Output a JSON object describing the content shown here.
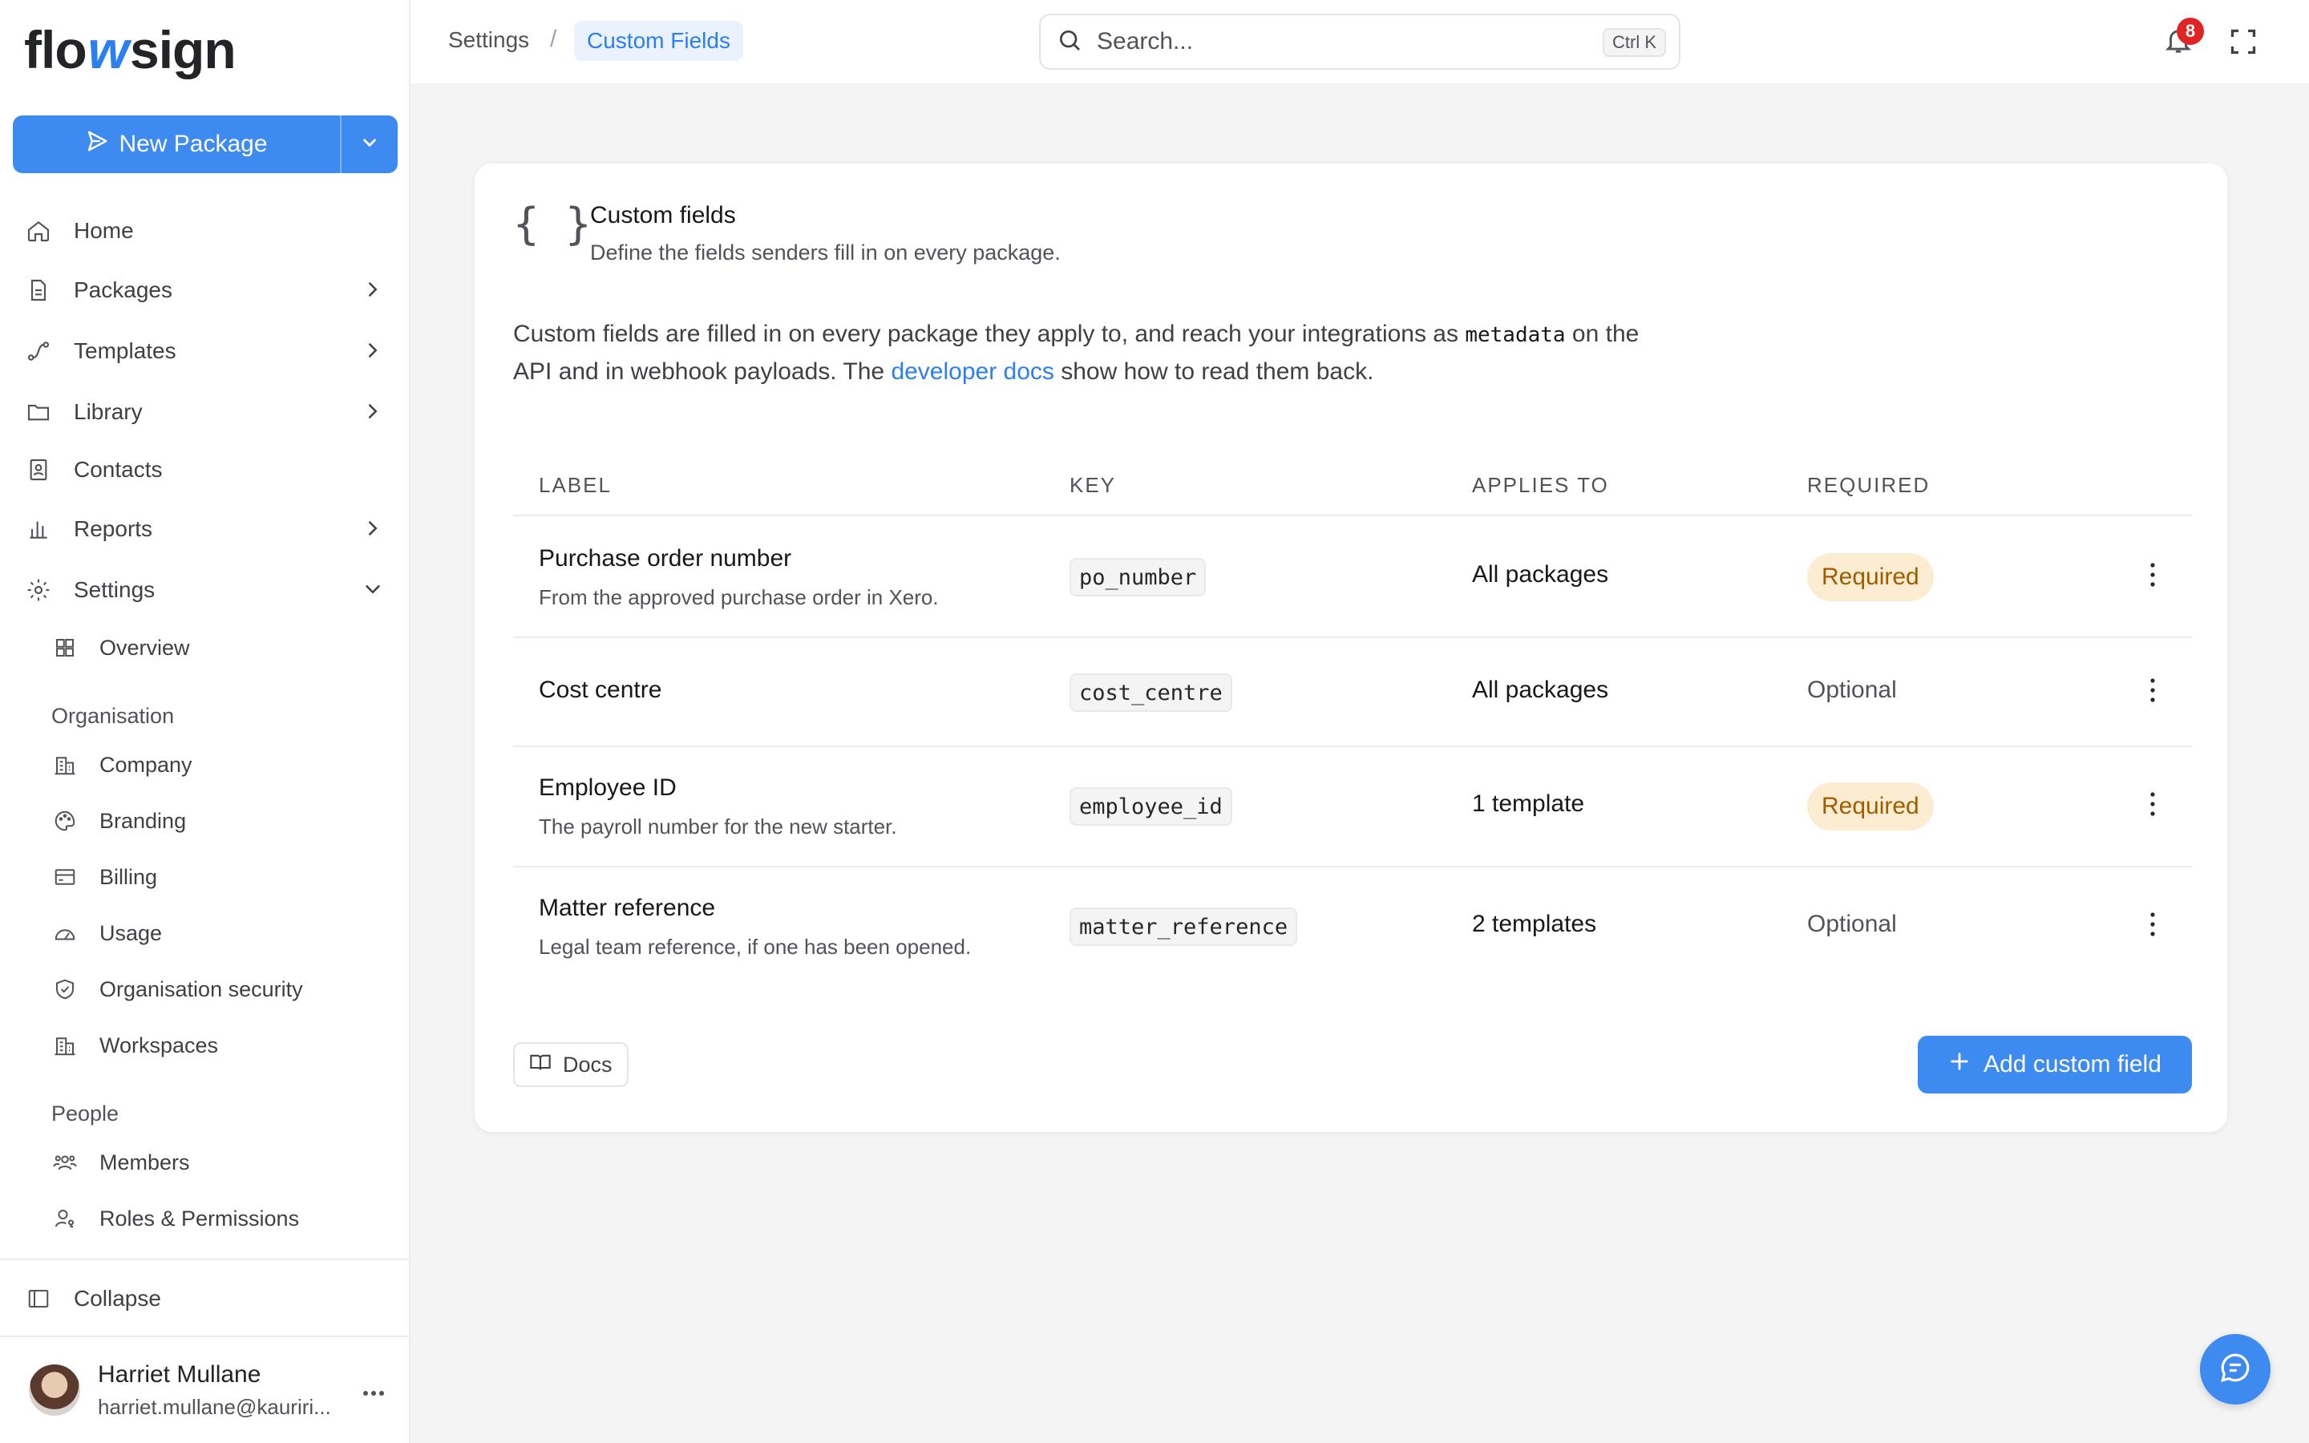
{
  "brand": {
    "logo_left": "flo",
    "logo_mid": "w",
    "logo_right": "sign",
    "accent": "#3d8bf0"
  },
  "sidebar": {
    "new_package_label": "New Package",
    "nav": [
      {
        "label": "Home",
        "icon": "home-icon"
      },
      {
        "label": "Packages",
        "icon": "document-icon"
      },
      {
        "label": "Templates",
        "icon": "route-icon"
      },
      {
        "label": "Library",
        "icon": "folder-icon"
      },
      {
        "label": "Contacts",
        "icon": "contact-book-icon"
      },
      {
        "label": "Reports",
        "icon": "bar-chart-icon"
      },
      {
        "label": "Settings",
        "icon": "gear-icon"
      }
    ],
    "settings_overview": "Overview",
    "org_section": "Organisation",
    "org_items": [
      "Company",
      "Branding",
      "Billing",
      "Usage",
      "Organisation security",
      "Workspaces"
    ],
    "people_section": "People",
    "people_items": [
      "Members",
      "Roles & Permissions"
    ],
    "collapse_label": "Collapse",
    "user": {
      "name": "Harriet Mullane",
      "email": "harriet.mullane@kauriri..."
    }
  },
  "topbar": {
    "breadcrumb": [
      "Settings",
      "Custom Fields"
    ],
    "breadcrumb_sep": "/",
    "search_placeholder": "Search...",
    "search_shortcut": "Ctrl K",
    "notification_count": "8"
  },
  "card": {
    "icon_glyph": "{ }",
    "title": "Custom fields",
    "subtitle": "Define the fields senders fill in on every package.",
    "intro_part1": "Custom fields are filled in on every package they apply to, and reach your integrations as ",
    "intro_code": "metadata",
    "intro_part2": " on the API and in webhook payloads. The ",
    "intro_link": "developer docs",
    "intro_part3": " show how to read them back.",
    "columns": [
      "LABEL",
      "KEY",
      "APPLIES TO",
      "REQUIRED"
    ],
    "rows": [
      {
        "label": "Purchase order number",
        "description": "From the approved purchase order in Xero.",
        "key": "po_number",
        "applies_to": "All packages",
        "required": "Required"
      },
      {
        "label": "Cost centre",
        "description": "",
        "key": "cost_centre",
        "applies_to": "All packages",
        "required": "Optional"
      },
      {
        "label": "Employee ID",
        "description": "The payroll number for the new starter.",
        "key": "employee_id",
        "applies_to": "1 template",
        "required": "Required"
      },
      {
        "label": "Matter reference",
        "description": "Legal team reference, if one has been opened.",
        "key": "matter_reference",
        "applies_to": "2 templates",
        "required": "Optional"
      }
    ],
    "docs_label": "Docs",
    "add_label": "Add custom field"
  }
}
